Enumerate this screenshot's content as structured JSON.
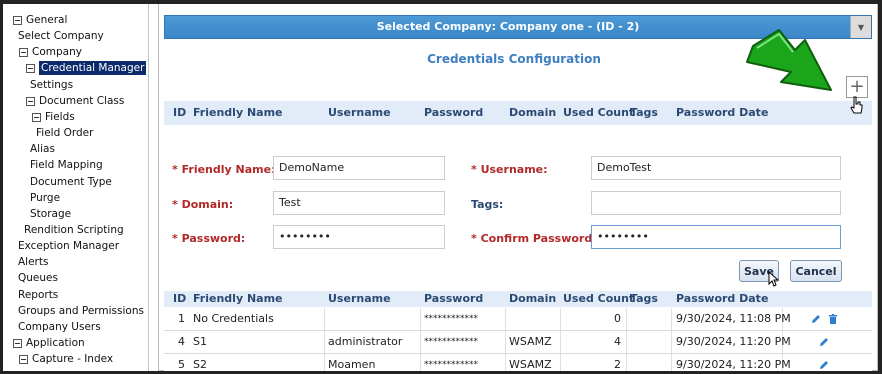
{
  "sidebar": {
    "items": [
      {
        "label": "General",
        "expander": true
      },
      {
        "label": "Select Company"
      },
      {
        "label": "Company",
        "expander": true
      },
      {
        "label": "Credential Manager",
        "expander": true,
        "selected": true
      },
      {
        "label": "Settings"
      },
      {
        "label": "Document Class",
        "expander": true
      },
      {
        "label": "Fields",
        "expander": true
      },
      {
        "label": "Field Order"
      },
      {
        "label": "Alias"
      },
      {
        "label": "Field Mapping"
      },
      {
        "label": "Document Type"
      },
      {
        "label": "Purge"
      },
      {
        "label": "Storage"
      },
      {
        "label": "Rendition Scripting"
      },
      {
        "label": "Exception Manager"
      },
      {
        "label": "Alerts"
      },
      {
        "label": "Queues"
      },
      {
        "label": "Reports"
      },
      {
        "label": "Groups and Permissions"
      },
      {
        "label": "Company Users"
      },
      {
        "label": "Application",
        "expander": true
      },
      {
        "label": "Capture - Index",
        "expander": true
      }
    ]
  },
  "header": {
    "company_title": "Selected Company: Company one - (ID - 2)",
    "section_title": "Credentials Configuration",
    "add_symbol": "+"
  },
  "columns": [
    "ID",
    "Friendly Name",
    "Username",
    "Password",
    "Domain",
    "Used Count",
    "Tags",
    "Password Date"
  ],
  "form": {
    "friendly_name_label": "* Friendly Name:",
    "friendly_name_value": "DemoName",
    "username_label": "* Username:",
    "username_value": "DemoTest",
    "domain_label": "* Domain:",
    "domain_value": "Test",
    "tags_label": "Tags:",
    "tags_value": "",
    "password_label": "* Password:",
    "password_value": "••••••••",
    "confirm_password_label": "* Confirm Password:",
    "confirm_password_value": "••••••••",
    "save_label": "Save",
    "cancel_label": "Cancel"
  },
  "rows": [
    {
      "id": "1",
      "friendly_name": "No Credentials",
      "username": "",
      "password": "************",
      "domain": "",
      "used_count": "0",
      "tags": "",
      "password_date": "9/30/2024, 11:08 PM",
      "actions": [
        "edit",
        "delete"
      ]
    },
    {
      "id": "4",
      "friendly_name": "S1",
      "username": "administrator",
      "password": "************",
      "domain": "WSAMZ",
      "used_count": "4",
      "tags": "",
      "password_date": "9/30/2024, 11:20 PM",
      "actions": [
        "edit"
      ]
    },
    {
      "id": "5",
      "friendly_name": "S2",
      "username": "Moamen",
      "password": "************",
      "domain": "WSAMZ",
      "used_count": "2",
      "tags": "",
      "password_date": "9/30/2024, 11:20 PM",
      "actions": [
        "edit"
      ]
    }
  ],
  "colors": {
    "accent_blue": "#3a86c8",
    "header_text": "#2b4a73",
    "required_red": "#b32828",
    "selected_nav": "#0b2a6b",
    "arrow_green": "#1aa51a",
    "icon_blue": "#2f7fd0"
  },
  "icons": [
    "chevron-down-icon",
    "plus-icon",
    "pencil-icon",
    "trash-icon",
    "green-arrow-icon",
    "hand-cursor-icon"
  ]
}
